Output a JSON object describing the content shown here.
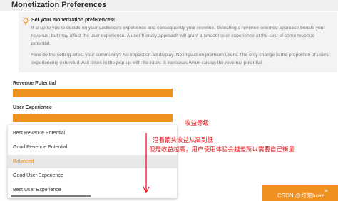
{
  "header": {
    "title": "Monetization Preferences"
  },
  "info": {
    "title": "Set your monetization preferences!",
    "paragraph1": "It is up to you to decide on your audience's experience and consequently your revenue. Selecting a revenue-oriented approach boosts your revenue, but may affect the user experience. A user friendly approach will grant a smooth user experience at the cost of some revenue potential.",
    "paragraph2": "How do the setting affect your community? No impact on ad display. No impact on premium users. The only change is the proportion of users experiencing extended wait times in the pop-up with the rates. It increases when raising the revenue potential.",
    "icon": "lightbulb-icon"
  },
  "fields": {
    "revenue_label": "Revenue Potential",
    "ux_label": "User Experience"
  },
  "dropdown": {
    "options": [
      "Best Revenue Potential",
      "Good Revenue Potential",
      "Balanced",
      "Good User Experience",
      "Best User Experience"
    ],
    "selected": "Balanced"
  },
  "annotations": {
    "title": "收益等级",
    "line1": "沿着箭头收益从高到低",
    "line2": "但是收益越高，用户使用体验会越差所以需要自己衡量"
  },
  "footer": {
    "watermark": "CSDN @灯笼boke"
  },
  "colors": {
    "accent": "#f0901e",
    "annotation": "#e8141a",
    "selected_bg": "#e8e8e8"
  }
}
